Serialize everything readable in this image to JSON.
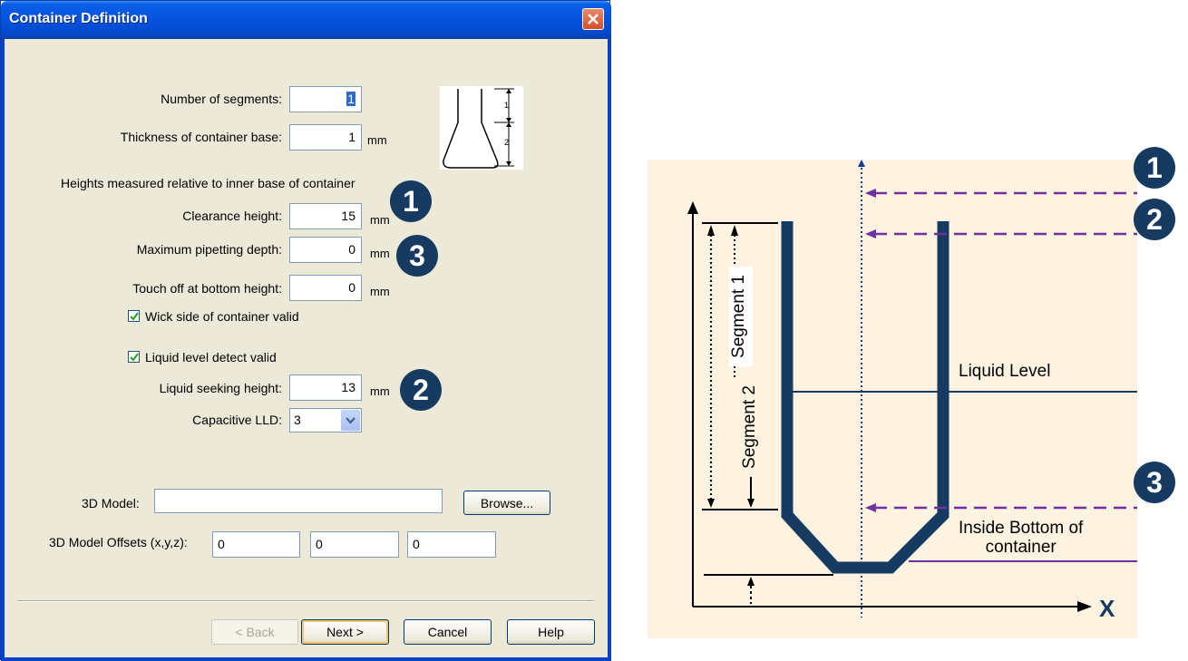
{
  "dialog": {
    "title": "Container Definition",
    "fields": {
      "num_segments": {
        "label": "Number of segments:",
        "value": "1"
      },
      "base_thickness": {
        "label": "Thickness of container base:",
        "value": "1",
        "unit": "mm"
      },
      "heights_note": "Heights measured relative to inner base of container",
      "clearance_height": {
        "label": "Clearance height:",
        "value": "15",
        "unit": "mm"
      },
      "max_pipetting_depth": {
        "label": "Maximum pipetting depth:",
        "value": "0",
        "unit": "mm"
      },
      "touch_off_height": {
        "label": "Touch off at bottom height:",
        "value": "0",
        "unit": "mm"
      },
      "wick_side": {
        "label": "Wick side of container valid",
        "checked": true
      },
      "lld_valid": {
        "label": "Liquid level detect valid",
        "checked": true
      },
      "liquid_seeking_height": {
        "label": "Liquid seeking height:",
        "value": "13",
        "unit": "mm"
      },
      "capacitive_lld": {
        "label": "Capacitive LLD:",
        "selected": "3"
      },
      "model_3d": {
        "label": "3D Model:",
        "value": "",
        "browse_label": "Browse..."
      },
      "model_offsets": {
        "label": "3D Model Offsets (x,y,z):",
        "x": "0",
        "y": "0",
        "z": "0"
      }
    },
    "thumbnail_labels": {
      "seg1": "1",
      "seg2": "2"
    },
    "badges": {
      "clearance": "1",
      "pipetting_depth": "3",
      "seeking": "2"
    },
    "buttons": {
      "back": "< Back",
      "next": "Next >",
      "cancel": "Cancel",
      "help": "Help"
    }
  },
  "figure": {
    "badges": {
      "b1": "1",
      "b2": "2",
      "b3": "3"
    },
    "segment1_label": "Segment  1",
    "segment2_label": "Segment  2",
    "liquid_level_label": "Liquid Level",
    "inside_bottom_label_line1": "Inside Bottom of",
    "inside_bottom_label_line2": "container",
    "x_axis_label": "X",
    "colors": {
      "container": "#173a61",
      "dashed": "#7030a0",
      "background": "#fdf3e0",
      "badge": "#173a61"
    }
  }
}
